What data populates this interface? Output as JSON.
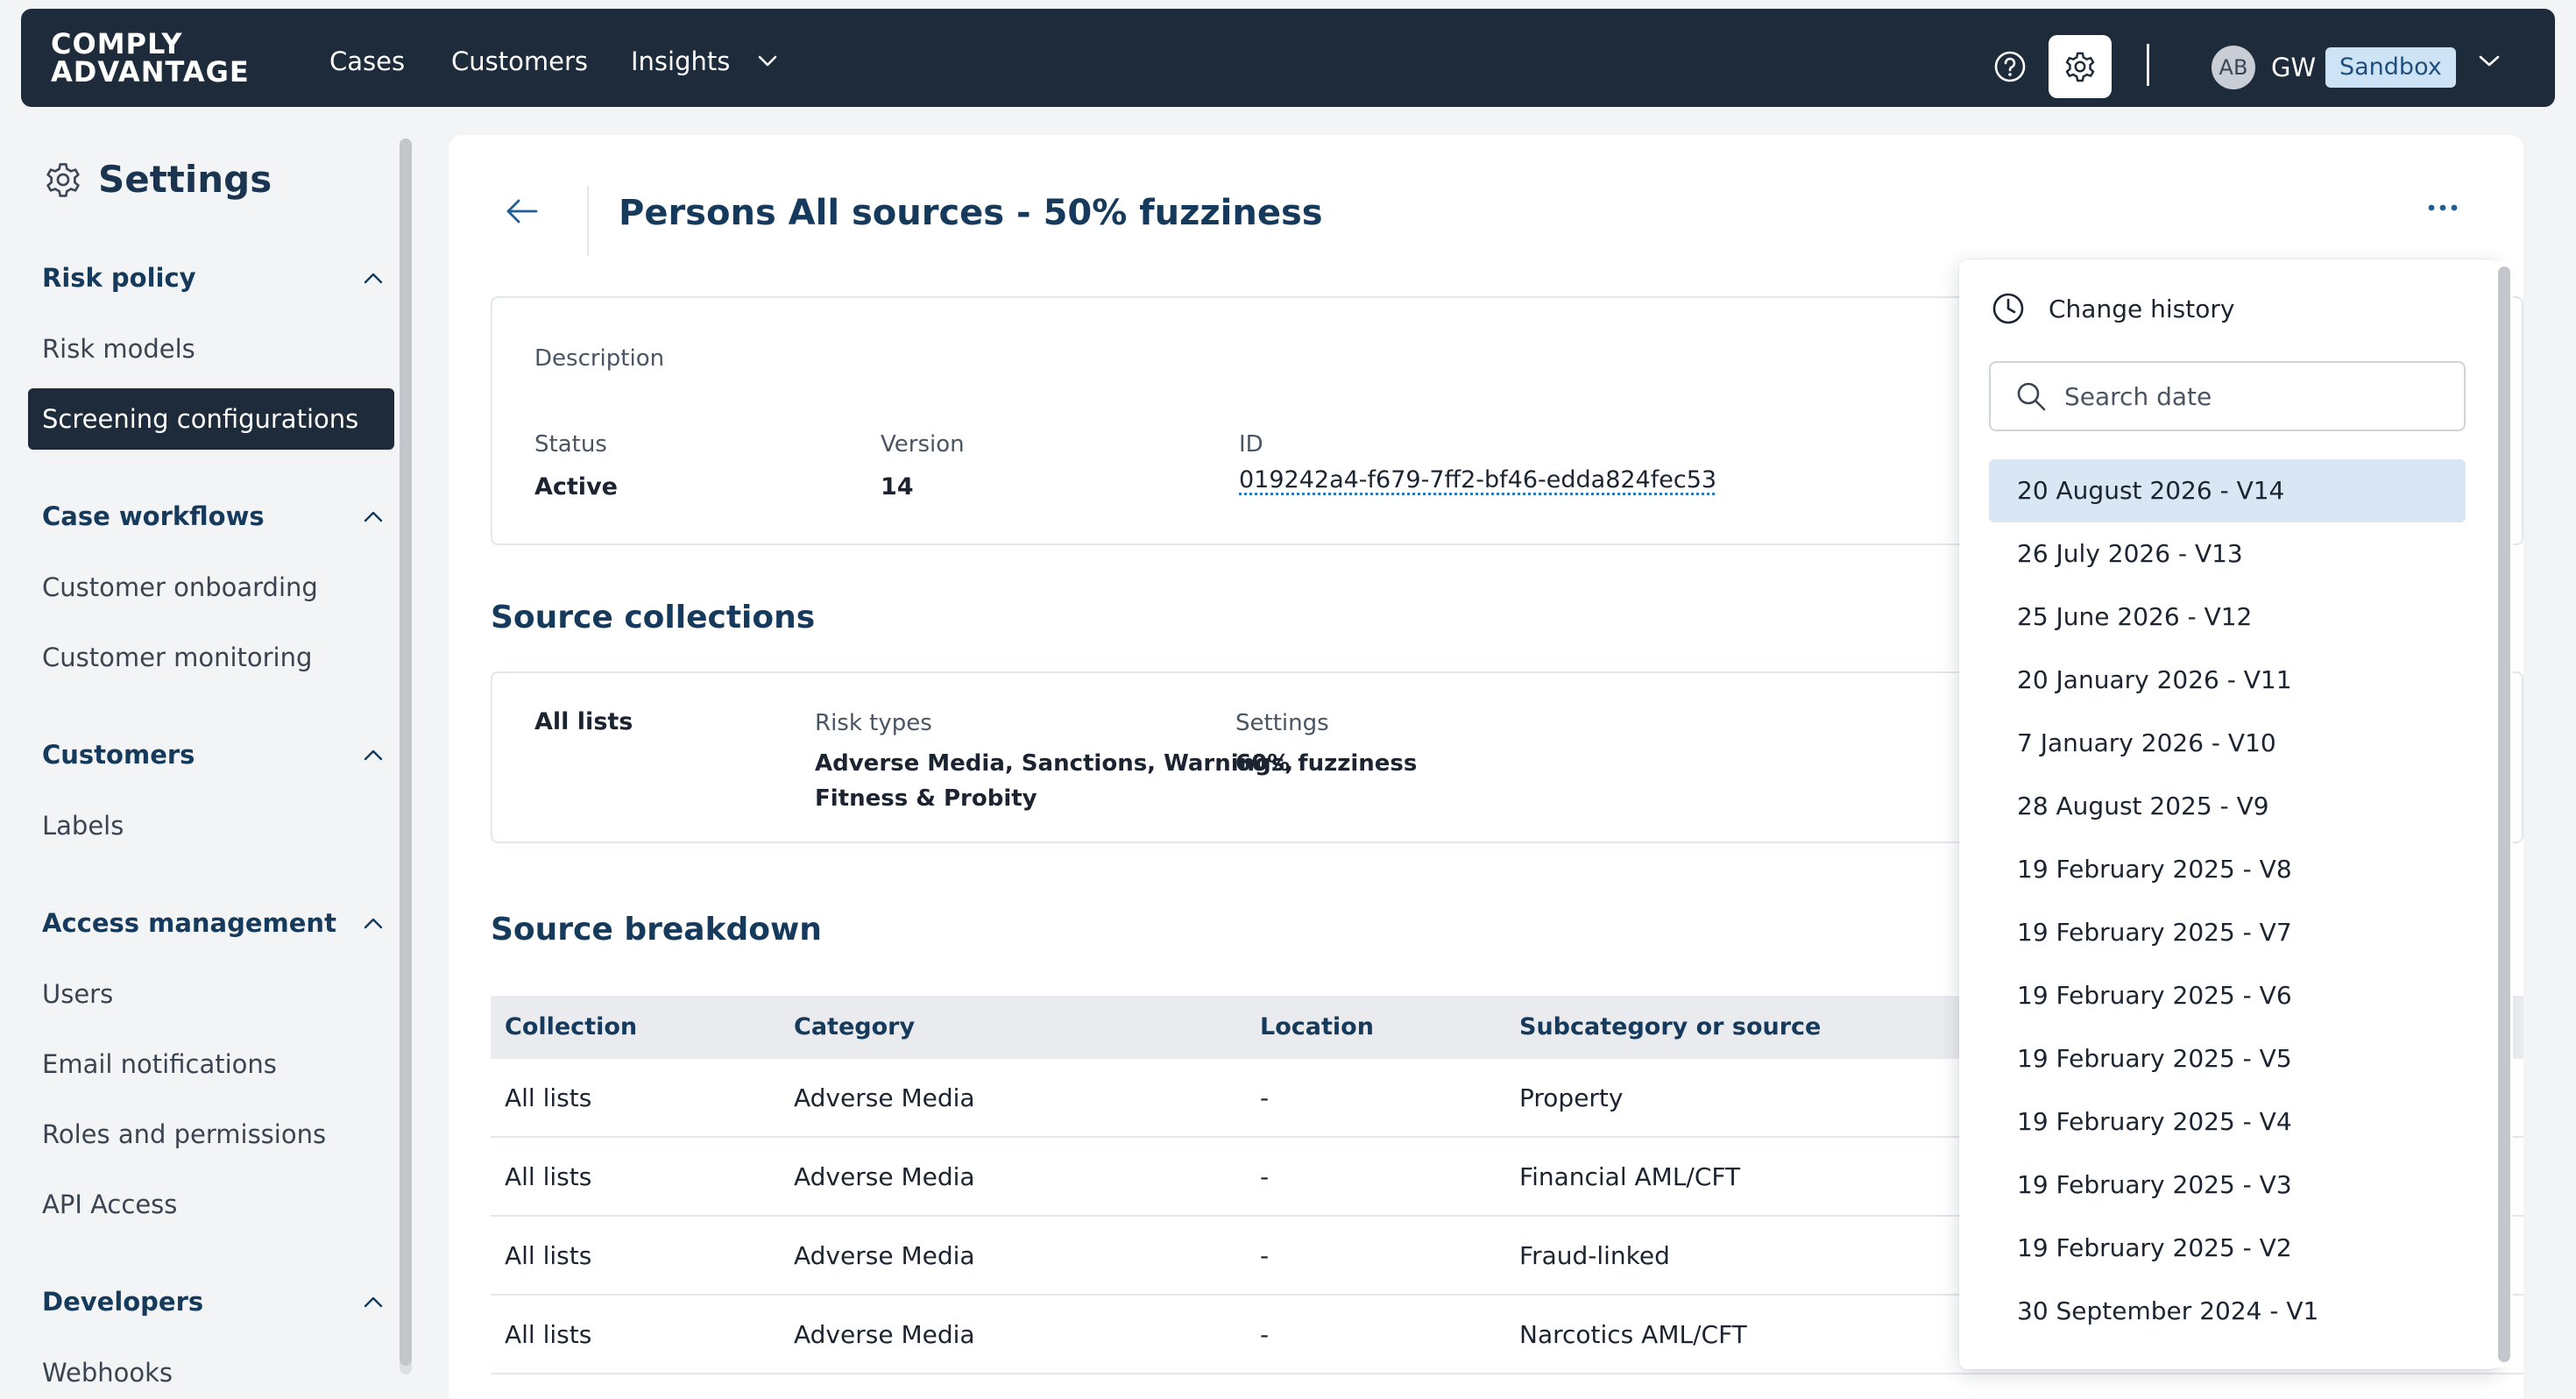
{
  "brand": {
    "line1": "COMPLY",
    "line2": "ADVANTAGE"
  },
  "nav": {
    "cases": "Cases",
    "customers": "Customers",
    "insights": "Insights"
  },
  "account": {
    "avatar": "AB",
    "initials": "GW",
    "env": "Sandbox"
  },
  "sidebar": {
    "title": "Settings",
    "sections": [
      {
        "title": "Risk policy",
        "items": [
          "Risk models",
          "Screening configurations"
        ]
      },
      {
        "title": "Case workflows",
        "items": [
          "Customer onboarding",
          "Customer monitoring"
        ]
      },
      {
        "title": "Customers",
        "items": [
          "Labels"
        ]
      },
      {
        "title": "Access management",
        "items": [
          "Users",
          "Email notifications",
          "Roles and permissions",
          "API Access"
        ]
      },
      {
        "title": "Developers",
        "items": [
          "Webhooks"
        ]
      }
    ]
  },
  "page": {
    "title": "Persons All sources - 50% fuzziness",
    "description_label": "Description",
    "status_label": "Status",
    "status_value": "Active",
    "version_label": "Version",
    "version_value": "14",
    "id_label": "ID",
    "id_value": "019242a4-f679-7ff2-bf46-edda824fec53"
  },
  "source_collections": {
    "heading": "Source collections",
    "name": "All lists",
    "risk_types_label": "Risk types",
    "risk_types_line1": "Adverse Media, Sanctions, Warnings,",
    "risk_types_line2": "Fitness & Probity",
    "settings_label": "Settings",
    "settings_value": "60% fuzziness"
  },
  "source_breakdown": {
    "heading": "Source breakdown",
    "columns": [
      "Collection",
      "Category",
      "Location",
      "Subcategory or source"
    ],
    "rows": [
      [
        "All lists",
        "Adverse Media",
        "-",
        "Property"
      ],
      [
        "All lists",
        "Adverse Media",
        "-",
        "Financial AML/CFT"
      ],
      [
        "All lists",
        "Adverse Media",
        "-",
        "Fraud-linked"
      ],
      [
        "All lists",
        "Adverse Media",
        "-",
        "Narcotics AML/CFT"
      ]
    ]
  },
  "change_history": {
    "title": "Change history",
    "search_placeholder": "Search date",
    "items": [
      "20 August 2026 - V14",
      "26 July 2026 - V13",
      "25 June 2026 - V12",
      "20 January 2026 - V11",
      "7 January 2026 - V10",
      "28 August 2025 - V9",
      "19 February 2025 - V8",
      "19 February 2025 - V7",
      "19 February 2025 - V6",
      "19 February 2025 - V5",
      "19 February 2025 - V4",
      "19 February 2025 - V3",
      "19 February 2025 - V2",
      "30 September 2024 - V1"
    ]
  }
}
